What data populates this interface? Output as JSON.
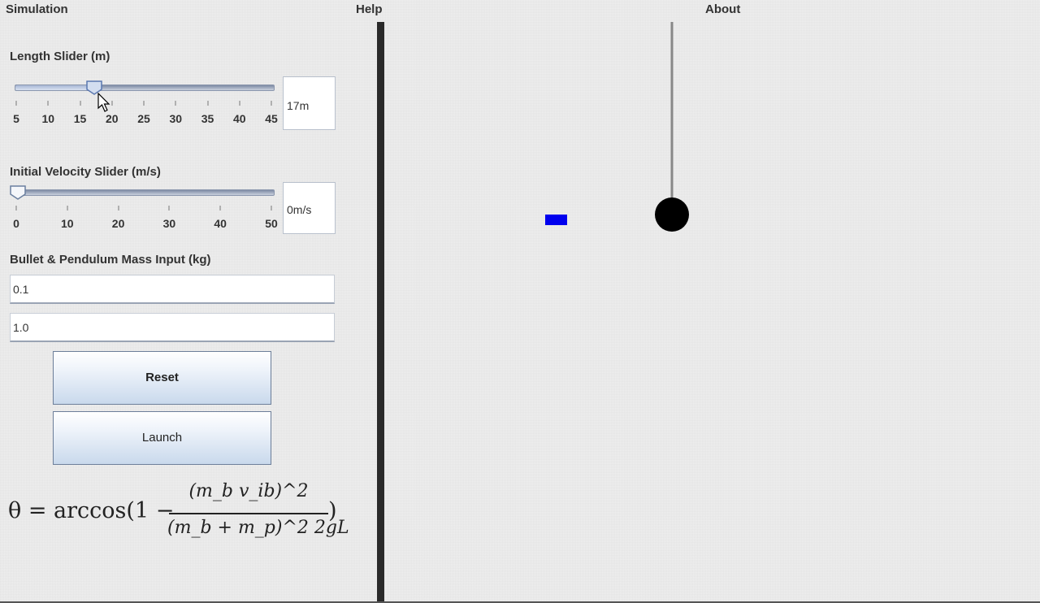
{
  "menu": {
    "simulation": "Simulation",
    "help": "Help",
    "about": "About"
  },
  "length_slider": {
    "label": "Length Slider (m)",
    "min": 5,
    "max": 45,
    "value": 17,
    "ticks": [
      "5",
      "10",
      "15",
      "20",
      "25",
      "30",
      "35",
      "40",
      "45"
    ],
    "display": "17m"
  },
  "velocity_slider": {
    "label": "Initial Velocity Slider (m/s)",
    "min": 0,
    "max": 50,
    "value": 0,
    "ticks": [
      "0",
      "10",
      "20",
      "30",
      "40",
      "50"
    ],
    "display": "0m/s"
  },
  "mass_input": {
    "label": "Bullet & Pendulum Mass Input (kg)",
    "bullet_mass": "0.1",
    "pendulum_mass": "1.0"
  },
  "buttons": {
    "reset": "Reset",
    "launch": "Launch"
  },
  "formula": {
    "lhs": "θ = arccos(1 −",
    "numerator": "(m_b v_ib)^2",
    "denominator": "(m_b + m_p)^2 2gL",
    "close": ")"
  },
  "colors": {
    "bullet": "#0000ee",
    "bob": "#000000",
    "string": "#888888",
    "divider": "#2a2a2a"
  }
}
